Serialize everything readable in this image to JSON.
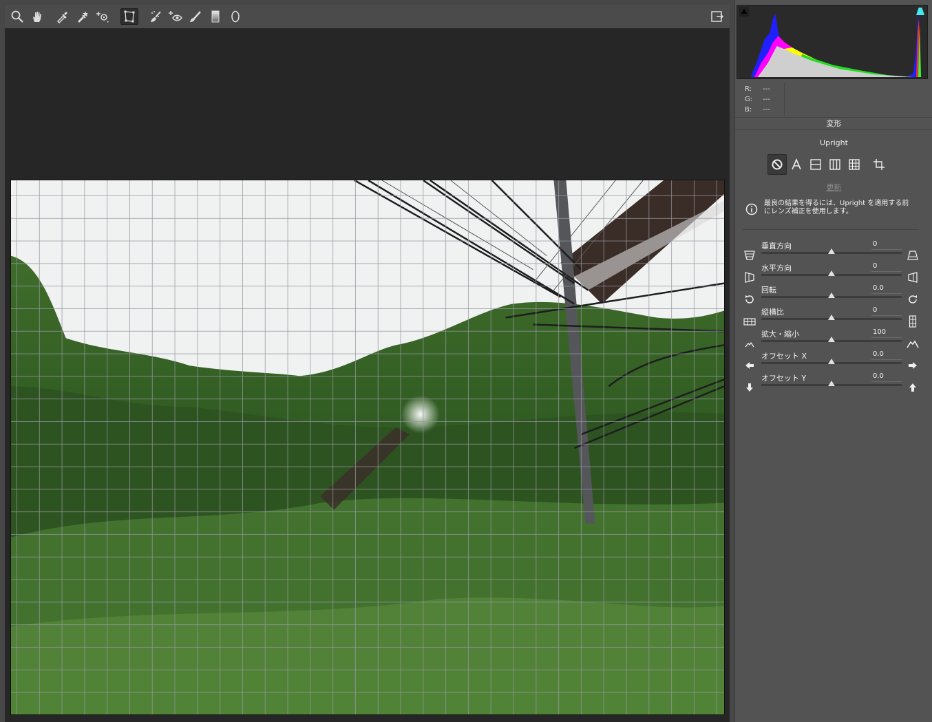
{
  "toolbar": {
    "tools": [
      {
        "name": "zoom-tool",
        "icon": "magnifier-icon"
      },
      {
        "name": "hand-tool",
        "icon": "hand-icon"
      },
      {
        "name": "white-balance-tool",
        "icon": "eyedropper-icon"
      },
      {
        "name": "color-sampler-tool",
        "icon": "color-sampler-icon"
      },
      {
        "name": "targeted-adjustment-tool",
        "icon": "target-adjust-icon"
      },
      {
        "name": "transform-tool",
        "icon": "transform-icon",
        "active": true
      },
      {
        "name": "spot-removal-tool",
        "icon": "spot-removal-icon"
      },
      {
        "name": "red-eye-tool",
        "icon": "red-eye-icon"
      },
      {
        "name": "adjustment-brush-tool",
        "icon": "brush-icon"
      },
      {
        "name": "graduated-filter-tool",
        "icon": "graduated-filter-icon"
      },
      {
        "name": "radial-filter-tool",
        "icon": "radial-filter-icon"
      }
    ],
    "export_icon": "open-panel-icon"
  },
  "readout": {
    "r_label": "R:",
    "r_value": "---",
    "g_label": "G:",
    "g_value": "---",
    "b_label": "B:",
    "b_value": "---"
  },
  "panel": {
    "title": "変形",
    "upright_label": "Upright",
    "update_link": "更新",
    "info_text_line1": "最良の結果を得るには、Upright を適用する前",
    "info_text_line2": "にレンズ補正を使用します。",
    "upright_buttons": [
      "off",
      "auto",
      "level",
      "vertical",
      "full",
      "guided"
    ]
  },
  "sliders": [
    {
      "key": "vertical",
      "label": "垂直方向",
      "value": "0",
      "position": 0.5,
      "icon_left": "vertical-perspective-icon",
      "icon_right": "vertical-perspective-alt-icon"
    },
    {
      "key": "horizontal",
      "label": "水平方向",
      "value": "0",
      "position": 0.5,
      "icon_left": "horizontal-perspective-icon",
      "icon_right": "horizontal-perspective-alt-icon"
    },
    {
      "key": "rotate",
      "label": "回転",
      "value": "0.0",
      "position": 0.5,
      "icon_left": "rotate-ccw-icon",
      "icon_right": "rotate-cw-icon"
    },
    {
      "key": "aspect",
      "label": "縦横比",
      "value": "0",
      "position": 0.5,
      "icon_left": "aspect-wide-icon",
      "icon_right": "aspect-tall-icon"
    },
    {
      "key": "scale",
      "label": "拡大・縮小",
      "value": "100",
      "position": 0.5,
      "icon_left": "scale-small-icon",
      "icon_right": "scale-large-icon"
    },
    {
      "key": "offset_x",
      "label": "オフセット X",
      "value": "0.0",
      "position": 0.5,
      "icon_left": "arrow-left-icon",
      "icon_right": "arrow-right-icon"
    },
    {
      "key": "offset_y",
      "label": "オフセット Y",
      "value": "0.0",
      "position": 0.5,
      "icon_left": "arrow-down-icon",
      "icon_right": "arrow-up-icon"
    }
  ],
  "colors": {
    "panel_bg": "#535353",
    "workspace_bg": "#262626",
    "highlight_clip": "#45e8ee"
  }
}
